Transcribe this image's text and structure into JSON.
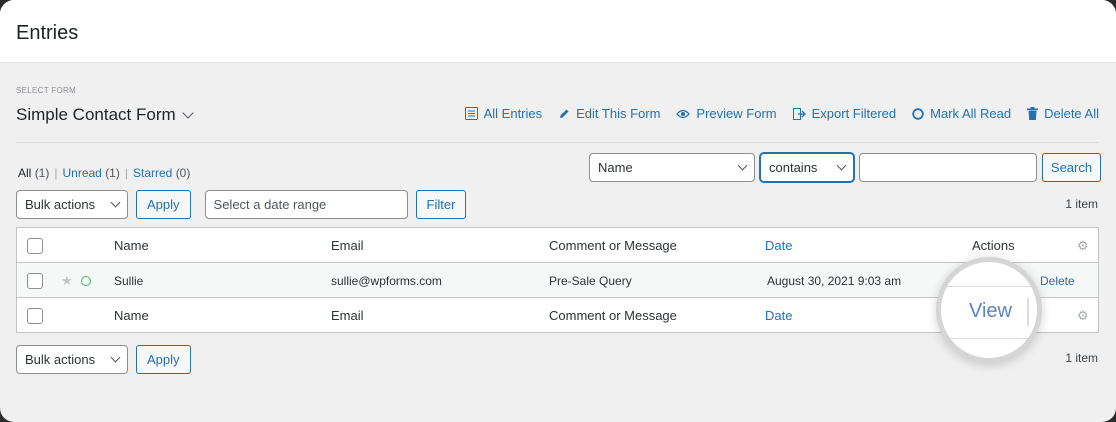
{
  "header": {
    "title": "Entries"
  },
  "form_select": {
    "label": "SELECT FORM",
    "name": "Simple Contact Form"
  },
  "actions": [
    {
      "label": "All Entries",
      "icon": "list-icon"
    },
    {
      "label": "Edit This Form",
      "icon": "pencil-icon"
    },
    {
      "label": "Preview Form",
      "icon": "eye-icon"
    },
    {
      "label": "Export Filtered",
      "icon": "export-icon"
    },
    {
      "label": "Mark All Read",
      "icon": "circle-icon"
    },
    {
      "label": "Delete All",
      "icon": "trash-icon"
    }
  ],
  "views": {
    "all": "All",
    "all_count": "(1)",
    "unread": "Unread",
    "unread_count": "(1)",
    "starred": "Starred",
    "starred_count": "(0)",
    "separator": "|"
  },
  "search": {
    "field": "Name",
    "operator": "contains",
    "value": "",
    "button": "Search"
  },
  "bulk": {
    "label": "Bulk actions",
    "apply": "Apply",
    "date_placeholder": "Select a date range",
    "filter": "Filter"
  },
  "item_count": "1 item",
  "table": {
    "columns": [
      "Name",
      "Email",
      "Comment or Message",
      "Date",
      "Actions"
    ],
    "rows": [
      {
        "name": "Sullie",
        "email": "sullie@wpforms.com",
        "message": "Pre-Sale Query",
        "date": "August 30, 2021 9:03 am",
        "view": "View",
        "delete": "Delete"
      }
    ]
  },
  "colors": {
    "link": "#2271b1",
    "unread_dot": "#4ab866"
  }
}
